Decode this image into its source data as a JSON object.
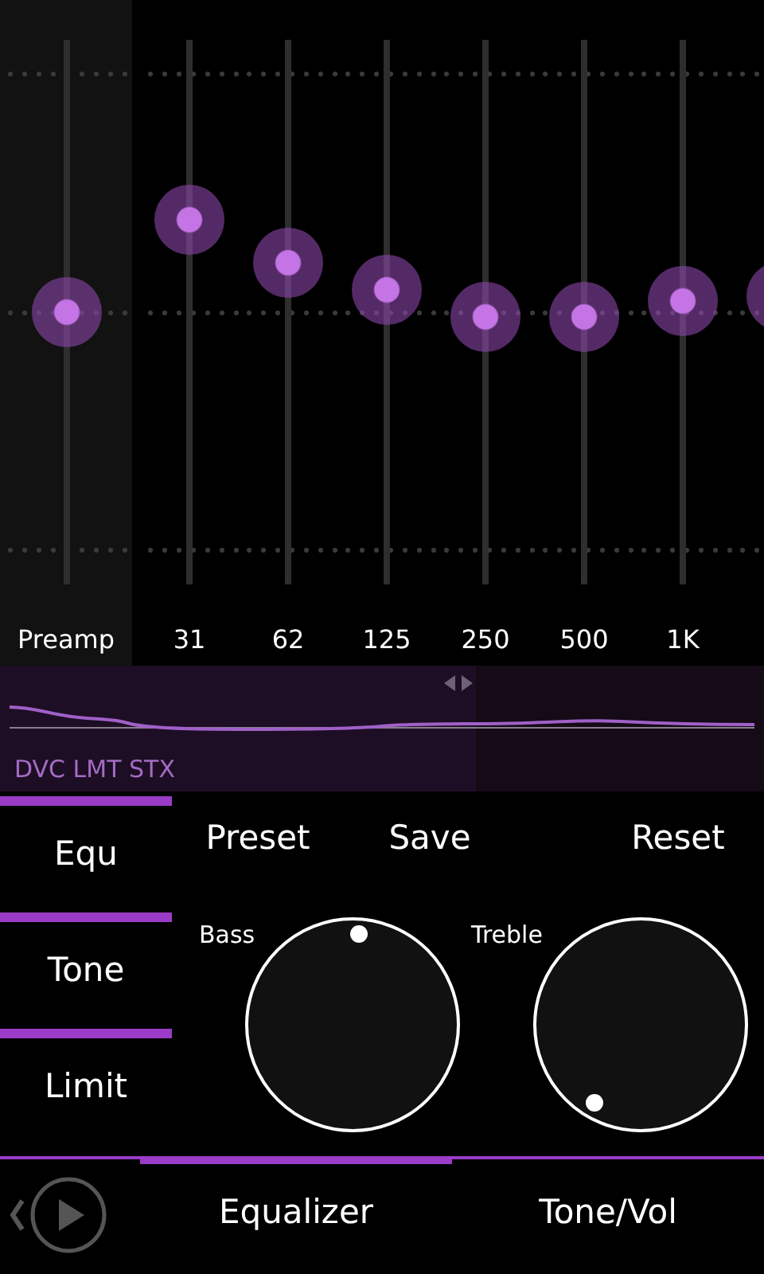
{
  "bands": [
    {
      "label": "Preamp",
      "kind": "preamp",
      "level": 0.5
    },
    {
      "label": "31",
      "kind": "band",
      "level": 0.67
    },
    {
      "label": "62",
      "kind": "band",
      "level": 0.59
    },
    {
      "label": "125",
      "kind": "band",
      "level": 0.54
    },
    {
      "label": "250",
      "kind": "band",
      "level": 0.49
    },
    {
      "label": "500",
      "kind": "band",
      "level": 0.49
    },
    {
      "label": "1K",
      "kind": "band",
      "level": 0.52
    },
    {
      "kind": "band",
      "level": 0.53
    }
  ],
  "response_panel": {
    "label": "DVC LMT STX"
  },
  "side_tabs": [
    {
      "label": "Equ"
    },
    {
      "label": "Tone"
    },
    {
      "label": "Limit"
    }
  ],
  "actions": [
    "Preset",
    "Save",
    "Reset"
  ],
  "knobs": [
    {
      "label": "Bass"
    },
    {
      "label": "Treble"
    }
  ],
  "bottom_tabs": [
    {
      "label": "Equalizer",
      "selected": true
    },
    {
      "label": "Tone/Vol",
      "selected": false
    }
  ]
}
